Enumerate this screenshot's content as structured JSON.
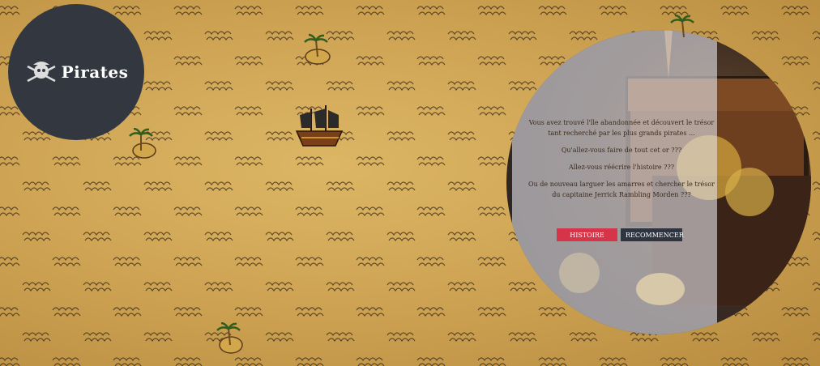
{
  "logo": {
    "title": "Pirates",
    "icon": "pirate-skull-icon"
  },
  "story": {
    "paragraphs": [
      "Vous avez trouvé l'île abandonnée et découvert le trésor tant recherché par les plus grands pirates ...",
      "Qu'allez-vous faire de tout cet or ???",
      "Allez-vous réécrire l'histoire ???",
      "Ou de nouveau larguer les amarres et chercher le trésor du capitaine Jerrick Rambling Morden ???"
    ]
  },
  "buttons": {
    "history": "HISTOIRE",
    "restart": "RECOMMENCER"
  },
  "colors": {
    "parchment": "#cfa555",
    "logo_bg": "#333840",
    "history_btn": "#d63448",
    "restart_btn": "#2f3540"
  }
}
